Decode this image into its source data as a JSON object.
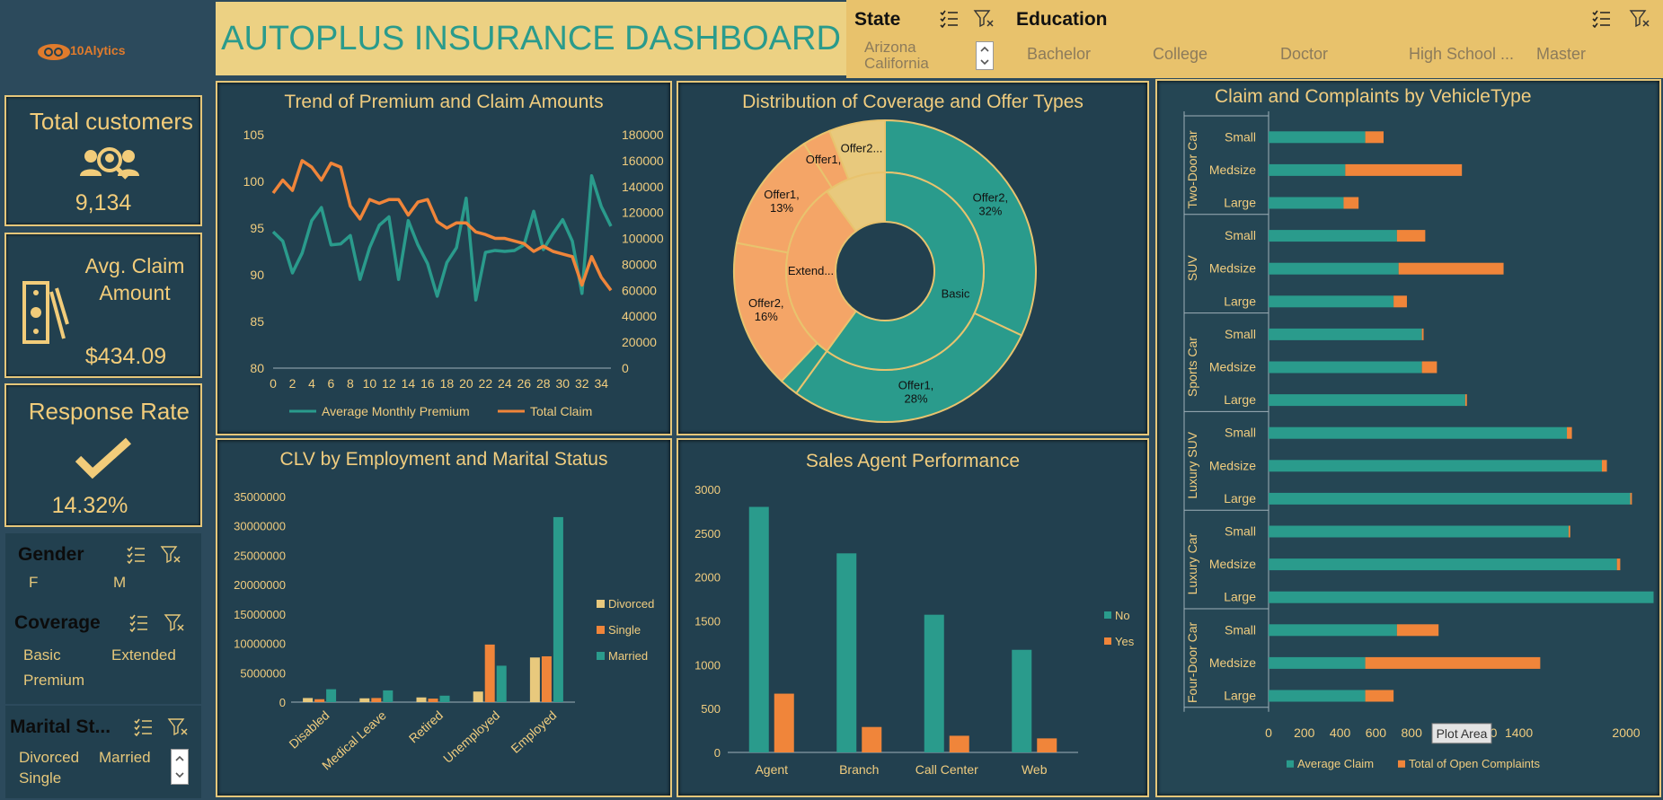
{
  "header": {
    "title": "AUTOPLUS INSURANCE DASHBOARD",
    "logo_text": "10Alytics"
  },
  "slicers": {
    "state": {
      "title": "State",
      "items": [
        "Arizona",
        "California"
      ]
    },
    "education": {
      "title": "Education",
      "items": [
        "Bachelor",
        "College",
        "Doctor",
        "High School ...",
        "Master"
      ]
    },
    "gender": {
      "title": "Gender",
      "items": [
        "F",
        "M"
      ]
    },
    "coverage": {
      "title": "Coverage",
      "items": [
        "Basic",
        "Extended",
        "Premium"
      ]
    },
    "marital": {
      "title": "Marital St...",
      "items": [
        "Divorced",
        "Married",
        "Single"
      ]
    }
  },
  "kpis": {
    "customers": {
      "label": "Total customers",
      "value": "9,134"
    },
    "claim": {
      "label1": "Avg. Claim",
      "label2": "Amount",
      "value": "$434.09"
    },
    "response": {
      "label": "Response Rate",
      "value": "14.32%"
    }
  },
  "colors": {
    "teal": "#2a9b8c",
    "orange": "#f0853a",
    "gold": "#e8c36e",
    "bg": "#22404f",
    "peach": "#f4a567",
    "beige": "#e8c97d"
  },
  "chart_data": [
    {
      "type": "line",
      "title": "Trend of Premium and Claim Amounts",
      "x": [
        0,
        1,
        2,
        3,
        4,
        5,
        6,
        7,
        8,
        9,
        10,
        11,
        12,
        13,
        14,
        15,
        16,
        17,
        18,
        19,
        20,
        21,
        22,
        23,
        24,
        25,
        26,
        27,
        28,
        29,
        30,
        31,
        32,
        33,
        34,
        35
      ],
      "xticks": [
        0,
        2,
        4,
        6,
        8,
        10,
        12,
        14,
        16,
        18,
        20,
        22,
        24,
        26,
        28,
        30,
        32,
        34
      ],
      "y_left_ticks": [
        80,
        85,
        90,
        95,
        100,
        105
      ],
      "y_right_ticks": [
        0,
        20000,
        40000,
        60000,
        80000,
        100000,
        120000,
        140000,
        160000,
        180000
      ],
      "ylim_left": [
        80,
        105
      ],
      "ylim_right": [
        0,
        180000
      ],
      "series": [
        {
          "name": "Average  Monthly Premium",
          "axis": "left",
          "values": [
            94.6,
            93.6,
            90.2,
            92.3,
            95.8,
            97.2,
            93.2,
            93.3,
            94.2,
            89.5,
            92.9,
            95.3,
            96.2,
            89.5,
            95.8,
            93.2,
            91.2,
            87.7,
            91.3,
            92.9,
            98.2,
            87.3,
            92.4,
            92.6,
            92.5,
            92.6,
            93.2,
            96.8,
            92.7,
            94.4,
            95.9,
            93.6,
            88.0,
            100.6,
            97.3,
            95.2
          ]
        },
        {
          "name": "Total Claim",
          "axis": "right",
          "values": [
            135000,
            145000,
            137000,
            160000,
            155000,
            145000,
            158000,
            155000,
            125000,
            115000,
            130000,
            127000,
            130000,
            130000,
            118000,
            128000,
            130000,
            113000,
            108000,
            112000,
            112000,
            105000,
            103000,
            100000,
            100000,
            98000,
            96000,
            90000,
            94000,
            90000,
            88000,
            86000,
            64000,
            86000,
            70000,
            60000
          ]
        }
      ]
    },
    {
      "type": "pie",
      "title": "Distribution of Coverage and Offer Types",
      "inner_ring": [
        {
          "label": "Basic",
          "value": 60
        },
        {
          "label": "Extend...",
          "value": 30
        },
        {
          "label": "",
          "value": 10
        }
      ],
      "outer_ring": [
        {
          "label": "Offer2, 32%",
          "value": 32
        },
        {
          "label": "Offer1, 28%",
          "value": 28
        },
        {
          "label": "",
          "value": 2
        },
        {
          "label": "Offer2, 16%",
          "value": 16
        },
        {
          "label": "Offer1, 13%",
          "value": 13
        },
        {
          "label": "Offer1,...",
          "value": 3
        },
        {
          "label": "Offer2...",
          "value": 6
        }
      ]
    },
    {
      "type": "bar",
      "title": "CLV by Employment and Marital Status",
      "categories": [
        "Disabled",
        "Medical Leave",
        "Retired",
        "Unemployed",
        "Employed"
      ],
      "yticks": [
        0,
        5000000,
        10000000,
        15000000,
        20000000,
        25000000,
        30000000,
        35000000
      ],
      "ylim": [
        0,
        35000000
      ],
      "series": [
        {
          "name": "Divorced",
          "values": [
            700000,
            650000,
            800000,
            1800000,
            7600000
          ]
        },
        {
          "name": "Single",
          "values": [
            500000,
            700000,
            600000,
            9800000,
            7800000
          ]
        },
        {
          "name": "Married",
          "values": [
            2200000,
            2000000,
            1100000,
            6200000,
            31500000
          ]
        }
      ]
    },
    {
      "type": "bar",
      "title": "Sales Agent Performance",
      "categories": [
        "Agent",
        "Branch",
        "Call Center",
        "Web"
      ],
      "yticks": [
        0,
        500,
        1000,
        1500,
        2000,
        2500,
        3000
      ],
      "ylim": [
        0,
        3000
      ],
      "series": [
        {
          "name": "No",
          "values": [
            2800,
            2270,
            1570,
            1170
          ]
        },
        {
          "name": "Yes",
          "values": [
            670,
            290,
            190,
            160
          ]
        }
      ]
    },
    {
      "type": "bar",
      "title": "Claim and Complaints by VehicleType",
      "groups": [
        {
          "name": "Two-Door Car",
          "rows": [
            {
              "size": "Small",
              "claim": 580,
              "complaints": 110
            },
            {
              "size": "Medsize",
              "claim": 460,
              "complaints": 700
            },
            {
              "size": "Large",
              "claim": 450,
              "complaints": 90
            }
          ]
        },
        {
          "name": "SUV",
          "rows": [
            {
              "size": "Small",
              "claim": 770,
              "complaints": 170
            },
            {
              "size": "Medsize",
              "claim": 780,
              "complaints": 630
            },
            {
              "size": "Large",
              "claim": 750,
              "complaints": 80
            }
          ]
        },
        {
          "name": "Sports Car",
          "rows": [
            {
              "size": "Small",
              "claim": 920,
              "complaints": 10
            },
            {
              "size": "Medsize",
              "claim": 920,
              "complaints": 90
            },
            {
              "size": "Large",
              "claim": 1180,
              "complaints": 10
            }
          ]
        },
        {
          "name": "Luxury SUV",
          "rows": [
            {
              "size": "Small",
              "claim": 1790,
              "complaints": 30
            },
            {
              "size": "Medsize",
              "claim": 2000,
              "complaints": 30
            },
            {
              "size": "Large",
              "claim": 2170,
              "complaints": 10
            }
          ]
        },
        {
          "name": "Luxury Car",
          "rows": [
            {
              "size": "Small",
              "claim": 1800,
              "complaints": 10
            },
            {
              "size": "Medsize",
              "claim": 2090,
              "complaints": 20
            },
            {
              "size": "Large",
              "claim": 2310,
              "complaints": 0
            }
          ]
        },
        {
          "name": "Four-Door Car",
          "rows": [
            {
              "size": "Small",
              "claim": 770,
              "complaints": 250
            },
            {
              "size": "Medsize",
              "claim": 580,
              "complaints": 1050
            },
            {
              "size": "Large",
              "claim": 580,
              "complaints": 170
            }
          ]
        }
      ],
      "xticks": [
        0,
        200,
        400,
        600,
        800,
        1000,
        1200,
        1400,
        2000
      ],
      "series_names": [
        "Average Claim",
        "Total of Open Complaints"
      ],
      "tooltip": "Plot Area"
    }
  ]
}
